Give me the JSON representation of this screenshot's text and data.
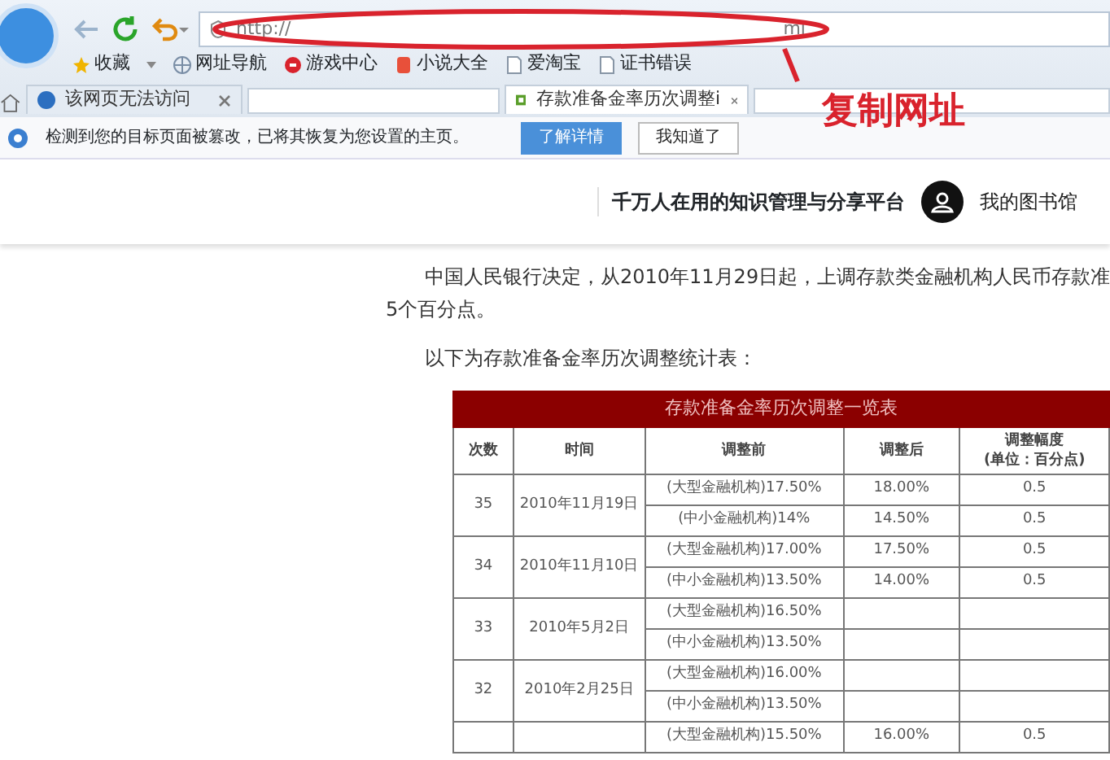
{
  "browser": {
    "address_bar": {
      "value": "http://",
      "suffix": "ml"
    },
    "bookmarks": [
      {
        "label": "收藏",
        "kind": "favorites"
      },
      {
        "label": "网址导航",
        "kind": "globe"
      },
      {
        "label": "游戏中心",
        "kind": "game"
      },
      {
        "label": "小说大全",
        "kind": "book"
      },
      {
        "label": "爱淘宝",
        "kind": "page"
      },
      {
        "label": "证书错误",
        "kind": "page"
      }
    ],
    "tabs": [
      {
        "title": "该网页无法访问",
        "selected": false
      },
      {
        "title": "存款准备金率历次调整i",
        "selected": true
      }
    ]
  },
  "info_bar": {
    "message": "检测到您的目标页面被篡改，已将其恢复为您设置的主页。",
    "buttons": [
      {
        "label": "了解详情",
        "primary": true
      },
      {
        "label": "我知道了",
        "primary": false
      }
    ]
  },
  "annotation": {
    "text": "复制网址"
  },
  "site_header": {
    "slogan": "千万人在用的知识管理与分享平台",
    "library_link": "我的图书馆"
  },
  "article": {
    "paragraphs": [
      {
        "lines": [
          "中国人民银行决定，从2010年11月29日起，上调存款类金融机构人民币存款准",
          "5个百分点。"
        ]
      },
      {
        "lines": [
          "以下为存款准备金率历次调整统计表："
        ]
      }
    ],
    "table": {
      "title": "存款准备金率历次调整一览表",
      "columns": [
        {
          "label": "次数"
        },
        {
          "label": "时间"
        },
        {
          "label": "调整前"
        },
        {
          "label": "调整后"
        },
        {
          "label": "调整幅度",
          "note": "(单位：百分点)"
        }
      ],
      "groups": [
        {
          "number": "35",
          "date": "2010年11月19日",
          "rows": [
            {
              "before": "(大型金融机构)17.50%",
              "after": "18.00%",
              "change": "0.5"
            },
            {
              "before": "(中小金融机构)14%",
              "after": "14.50%",
              "change": "0.5"
            }
          ]
        },
        {
          "number": "34",
          "date": "2010年11月10日",
          "rows": [
            {
              "before": "(大型金融机构)17.00%",
              "after": "17.50%",
              "change": "0.5"
            },
            {
              "before": "(中小金融机构)13.50%",
              "after": "14.00%",
              "change": "0.5"
            }
          ]
        },
        {
          "number": "33",
          "date": "2010年5月2日",
          "rows": [
            {
              "before": "(大型金融机构)16.50%"
            },
            {
              "before": "(中小金融机构)13.50%"
            }
          ]
        },
        {
          "number": "32",
          "date": "2010年2月25日",
          "rows": [
            {
              "before": "(大型金融机构)16.00%"
            },
            {
              "before": "(中小金融机构)13.50%"
            }
          ]
        },
        {
          "rows": [
            {
              "before": "(大型金融机构)15.50%",
              "after": "16.00%",
              "change": "0.5"
            }
          ]
        }
      ]
    }
  }
}
